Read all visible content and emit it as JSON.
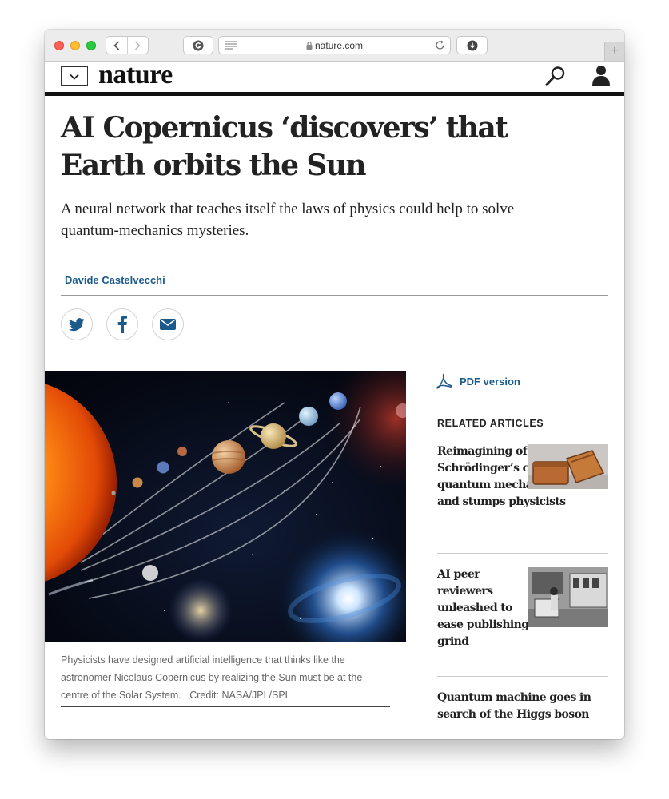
{
  "browser": {
    "url": "nature.com",
    "new_tab_label": "+"
  },
  "site": {
    "logo": "nature"
  },
  "article": {
    "headline": "AI Copernicus ‘discovers’ that Earth orbits the Sun",
    "standfirst": "A neural network that teaches itself the laws of physics could help to solve quantum-mechanics mysteries.",
    "author": "Davide Castelvecchi",
    "caption": "Physicists have designed artificial intelligence that thinks like the astronomer Nicolaus Copernicus by realizing the Sun must be at the centre of the Solar System.",
    "credit": "Credit: NASA/JPL/SPL"
  },
  "sidebar": {
    "pdf_label": "PDF version",
    "related_heading": "RELATED ARTICLES",
    "related": [
      {
        "title": "Reimagining of Schrödinger’s cat breaks quantum mechanics — and stumps physicists"
      },
      {
        "title": "AI peer reviewers unleashed to ease publishing grind"
      },
      {
        "title": "Quantum machine goes in search of the Higgs boson"
      }
    ]
  },
  "colors": {
    "link": "#1b5b8c",
    "header_rule": "#111111"
  }
}
